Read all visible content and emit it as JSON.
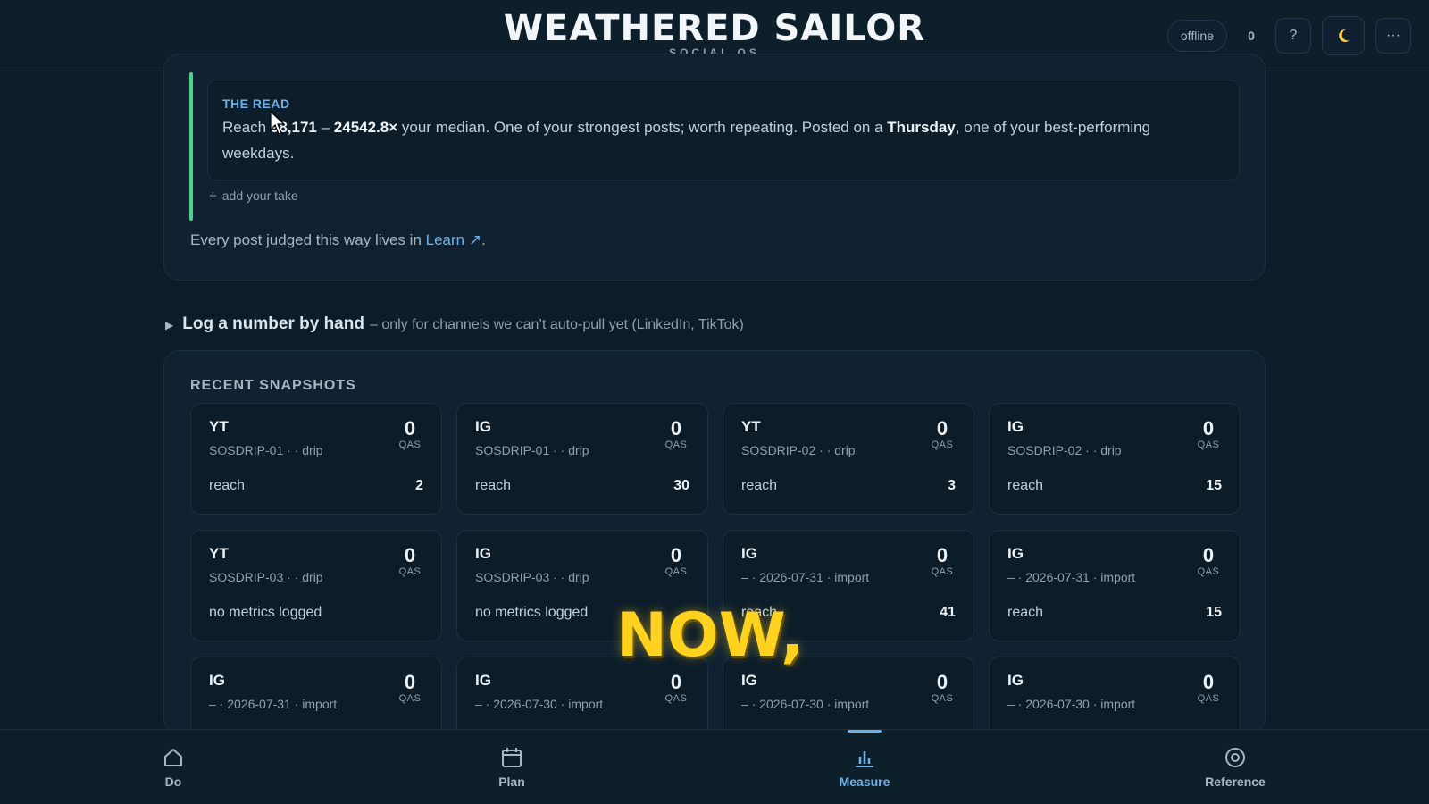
{
  "header": {
    "title": "WEATHERED SAILOR",
    "subtitle": "SOCIAL OS",
    "status": "offline",
    "count": "0",
    "help": "?",
    "more": "···"
  },
  "read": {
    "label": "THE READ",
    "text_before": "Reach ",
    "reach_value": "98,171",
    "dash": " – ",
    "multiplier": "24542.8×",
    "text_mid": " your median. One of your strongest posts; worth repeating. Posted on a ",
    "weekday": "Thursday",
    "text_after": ", one of your best-performing weekdays.",
    "add_take": "add your take",
    "learn_prefix": "Every post judged this way lives in ",
    "learn_link": "Learn ↗",
    "learn_suffix": "."
  },
  "log": {
    "title": "Log a number by hand",
    "note": "– only for channels we can’t auto-pull yet (LinkedIn, TikTok)"
  },
  "snapshots": {
    "title": "RECENT SNAPSHOTS",
    "score_label": "QAS",
    "items": [
      {
        "channel": "YT",
        "sub": "SOSDRIP-01 · · drip",
        "score": "0",
        "metric": "reach",
        "value": "2"
      },
      {
        "channel": "IG",
        "sub": "SOSDRIP-01 · · drip",
        "score": "0",
        "metric": "reach",
        "value": "30"
      },
      {
        "channel": "YT",
        "sub": "SOSDRIP-02 · · drip",
        "score": "0",
        "metric": "reach",
        "value": "3"
      },
      {
        "channel": "IG",
        "sub": "SOSDRIP-02 · · drip",
        "score": "0",
        "metric": "reach",
        "value": "15"
      },
      {
        "channel": "YT",
        "sub": "SOSDRIP-03 · · drip",
        "score": "0",
        "metric": "no metrics logged",
        "value": ""
      },
      {
        "channel": "IG",
        "sub": "SOSDRIP-03 · · drip",
        "score": "0",
        "metric": "no metrics logged",
        "value": ""
      },
      {
        "channel": "IG",
        "sub": "– · 2026-07-31 · import",
        "score": "0",
        "metric": "reach",
        "value": "41"
      },
      {
        "channel": "IG",
        "sub": "– · 2026-07-31 · import",
        "score": "0",
        "metric": "reach",
        "value": "15"
      },
      {
        "channel": "IG",
        "sub": "– · 2026-07-31 · import",
        "score": "0",
        "metric": "",
        "value": ""
      },
      {
        "channel": "IG",
        "sub": "– · 2026-07-30 · import",
        "score": "0",
        "metric": "",
        "value": ""
      },
      {
        "channel": "IG",
        "sub": "– · 2026-07-30 · import",
        "score": "0",
        "metric": "",
        "value": ""
      },
      {
        "channel": "IG",
        "sub": "– · 2026-07-30 · import",
        "score": "0",
        "metric": "",
        "value": ""
      }
    ]
  },
  "caption": "NOW,",
  "nav": {
    "do": "Do",
    "plan": "Plan",
    "measure": "Measure",
    "reference": "Reference",
    "active": "measure"
  },
  "colors": {
    "accent": "#6fb1e6",
    "green": "#4ad48a",
    "caption": "#ffd21f",
    "background": "#0c1c29"
  }
}
